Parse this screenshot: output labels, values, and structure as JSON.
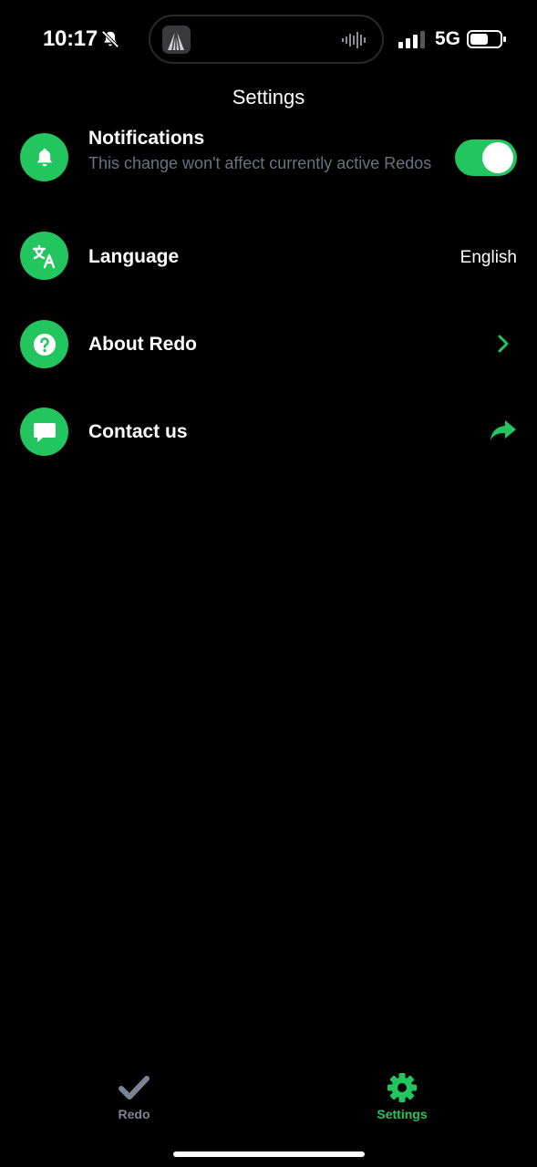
{
  "status_bar": {
    "time": "10:17",
    "network": "5G",
    "icons": [
      "bell-slash-icon",
      "app-icon",
      "audio-wave-icon",
      "signal-icon",
      "battery-icon"
    ]
  },
  "header": {
    "title": "Settings"
  },
  "settings": {
    "notifications": {
      "title": "Notifications",
      "subtitle": "This change won't affect currently active Redos",
      "toggle_on": true,
      "icon": "bell-icon"
    },
    "language": {
      "title": "Language",
      "value": "English",
      "icon": "translate-icon"
    },
    "about": {
      "title": "About Redo",
      "icon": "question-icon",
      "action_icon": "chevron-right-icon"
    },
    "contact": {
      "title": "Contact us",
      "icon": "chat-bubble-icon",
      "action_icon": "share-arrow-icon"
    }
  },
  "tab_bar": {
    "tabs": [
      {
        "label": "Redo",
        "icon": "checkmark-icon",
        "active": false
      },
      {
        "label": "Settings",
        "icon": "gear-icon",
        "active": true
      }
    ]
  },
  "colors": {
    "background": "#000000",
    "accent": "#22c55e",
    "subtitle": "#6b7280",
    "inactive_tab": "#7b8494"
  }
}
